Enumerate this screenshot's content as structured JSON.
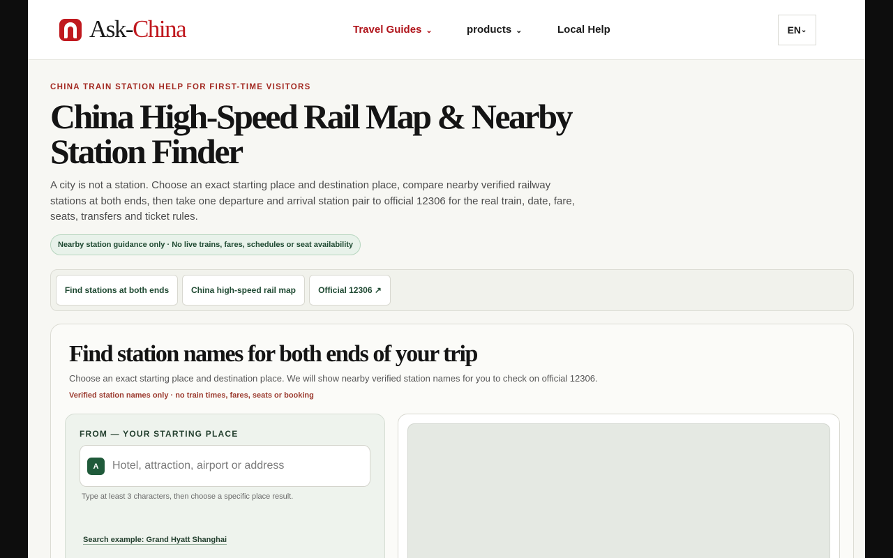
{
  "header": {
    "logo_prefix": "Ask-",
    "logo_accent": "China",
    "nav": {
      "travel_guides": "Travel Guides",
      "products": "products",
      "local_help": "Local Help"
    },
    "language": "EN"
  },
  "hero": {
    "eyebrow": "CHINA TRAIN STATION HELP FOR FIRST-TIME VISITORS",
    "title": "China High-Speed Rail Map & Nearby Station Finder",
    "lede": "A city is not a station. Choose an exact starting place and destination place, compare nearby verified railway stations at both ends, then take one departure and arrival station pair to official 12306 for the real train, date, fare, seats, transfers and ticket rules.",
    "notice": "Nearby station guidance only · No live trains, fares, schedules or seat availability"
  },
  "tabs": {
    "find_stations": "Find stations at both ends",
    "rail_map": "China high-speed rail map",
    "official": "Official 12306 ↗"
  },
  "finder": {
    "title": "Find station names for both ends of your trip",
    "subtitle": "Choose an exact starting place and destination place. We will show nearby verified station names for you to check on official 12306.",
    "note": "Verified station names only · no train times, fares, seats or booking",
    "from_label": "FROM — YOUR STARTING PLACE",
    "from_pin": "A",
    "from_placeholder": "Hotel, attraction, airport or address",
    "from_value": "",
    "hint": "Type at least 3 characters, then choose a specific place result.",
    "example": "Search example: Grand Hyatt Shanghai"
  },
  "icons": {
    "logo": "arch-logo-icon",
    "dropdown": "chevron-down-icon"
  },
  "colors": {
    "brand_red": "#c0181e",
    "accent_green": "#1f5a3a",
    "page_bg": "#f7f7f3"
  }
}
